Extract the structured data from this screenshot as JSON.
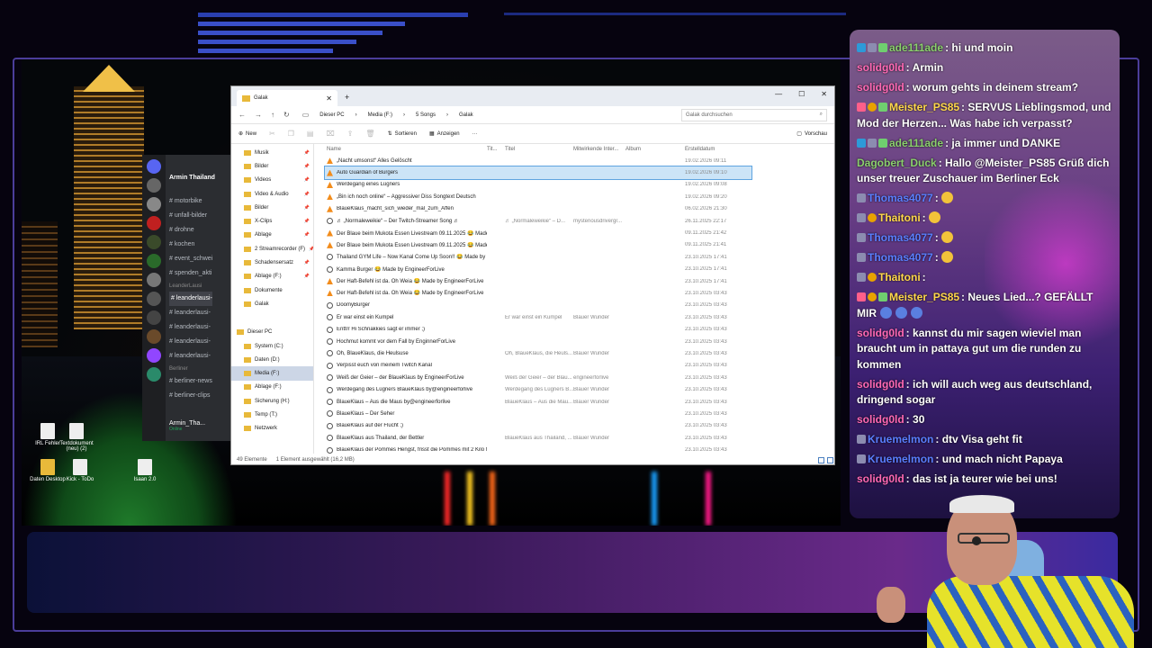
{
  "colors": {
    "chat_accent": "#8bd06d",
    "selection": "#cce4f7"
  },
  "desktop_icons": [
    {
      "label": "IRL Fehler",
      "type": "file"
    },
    {
      "label": "Textdokument (neu) (2)",
      "type": "file"
    },
    {
      "label": "Daten Desktop",
      "type": "folder"
    },
    {
      "label": "Kick - ToDo",
      "type": "file"
    },
    {
      "label": "Isaan 2.0",
      "type": "file"
    }
  ],
  "discord": {
    "server_name": "Armin Thailand",
    "channels": [
      {
        "label": "motorbike",
        "kind": "channel"
      },
      {
        "label": "unfall-bilder",
        "kind": "channel"
      },
      {
        "label": "drohne",
        "kind": "channel"
      },
      {
        "label": "kochen",
        "kind": "channel"
      },
      {
        "label": "event_schwei",
        "kind": "channel"
      },
      {
        "label": "spenden_akti",
        "kind": "channel"
      },
      {
        "label": "LeanderLausi",
        "kind": "category"
      },
      {
        "label": "leanderlausi-",
        "kind": "channel",
        "selected": true
      },
      {
        "label": "leanderlausi-",
        "kind": "channel"
      },
      {
        "label": "leanderlausi-",
        "kind": "channel"
      },
      {
        "label": "leanderlausi-",
        "kind": "channel"
      },
      {
        "label": "leanderlausi-",
        "kind": "channel"
      },
      {
        "label": "Berliner",
        "kind": "category"
      },
      {
        "label": "berliner-news",
        "kind": "channel"
      },
      {
        "label": "berliner-clips",
        "kind": "channel"
      }
    ],
    "user_name": "Armin_Tha...",
    "user_status": "Online"
  },
  "explorer": {
    "tab_title": "Galak",
    "breadcrumbs": [
      "Dieser PC",
      "Media (F:)",
      "5 Songs",
      "Galak"
    ],
    "search_placeholder": "Galak durchsuchen",
    "toolbar": {
      "new": "New",
      "sort": "Sortieren",
      "view": "Anzeigen",
      "more": "···",
      "preview": "Vorschau"
    },
    "nav_items": [
      {
        "label": "Musik",
        "pin": true
      },
      {
        "label": "Bilder",
        "pin": true
      },
      {
        "label": "Videos",
        "pin": true
      },
      {
        "label": "Video & Audio",
        "pin": true
      },
      {
        "label": "Bilder",
        "pin": true
      },
      {
        "label": "X-Clips",
        "pin": true
      },
      {
        "label": "Ablage",
        "pin": true
      },
      {
        "label": "2 Streamrecorder (F)",
        "pin": true
      },
      {
        "label": "Schadensersatz",
        "pin": true
      },
      {
        "label": "Ablage (F:)",
        "pin": true
      },
      {
        "label": "Dokumente"
      },
      {
        "label": "Galak"
      },
      {
        "label": "",
        "gap": true
      },
      {
        "label": "Dieser PC"
      },
      {
        "label": "System (C:)"
      },
      {
        "label": "Daten (D:)"
      },
      {
        "label": "Media (F:)",
        "selected": true
      },
      {
        "label": "Ablage (F:)"
      },
      {
        "label": "Sicherung (H:)"
      },
      {
        "label": "Temp (T:)"
      },
      {
        "label": "Netzwerk"
      }
    ],
    "columns": [
      "Name",
      "Tit...",
      "Titel",
      "Mitwirkende Inter...",
      "Album",
      "Erstelldatum"
    ],
    "rows": [
      {
        "name": "„Nacht umsonst“ Alles Gelöscht",
        "icon": "cone",
        "c2": "",
        "c3": "",
        "c4": "",
        "date": "19.02.2026 09:11"
      },
      {
        "name": "Auto Guardian of Burgers",
        "icon": "cone",
        "c2": "",
        "c3": "",
        "c4": "",
        "date": "19.02.2026 09:10",
        "selected": true
      },
      {
        "name": "Werdegang eines Lügners",
        "icon": "cone",
        "c2": "",
        "c3": "",
        "c4": "",
        "date": "19.02.2026 09:08"
      },
      {
        "name": "„Bin ich noch online“ – Aggressiver Diss Songtext Deutsch",
        "icon": "cone",
        "c2": "",
        "c3": "",
        "c4": "",
        "date": "19.02.2026 09:20"
      },
      {
        "name": "BlaueKlaus_macht_sich_wieder_mal_zum_Affen",
        "icon": "cone",
        "c2": "",
        "c3": "",
        "c4": "",
        "date": "06.02.2026 21:30"
      },
      {
        "name": "♬ „Normaleweikie“ – Der Twitch-Streamer Song ♬",
        "icon": "wmp",
        "c2": "♬ „Normaleweikie“ – D...",
        "c3": "mysteriousdrivergr...",
        "c4": "",
        "date": "26.11.2025 22:17"
      },
      {
        "name": "Der Blaue beim Mukota Essen Livestream 09.11.2025 😂 Made by ...",
        "icon": "cone",
        "c2": "",
        "c3": "",
        "c4": "",
        "date": "09.11.2025 21:42"
      },
      {
        "name": "Der Blaue beim Mukota Essen Livestream 09.11.2025 😂 Made by ...",
        "icon": "cone",
        "c2": "",
        "c3": "",
        "c4": "",
        "date": "09.11.2025 21:41"
      },
      {
        "name": "Thailand GYM Life – Now Kanal Come Up Soon!! 😂 Made by En...",
        "icon": "wmp",
        "c2": "",
        "c3": "",
        "c4": "",
        "date": "23.10.2025 17:41"
      },
      {
        "name": "Kamma Burger 😂 Made by EngineerForLive",
        "icon": "wmp",
        "c2": "",
        "c3": "",
        "c4": "",
        "date": "23.10.2025 17:41"
      },
      {
        "name": "Der Haft-Befehl ist da. Oh Weia 😂 Made by EngineerForLive",
        "icon": "cone",
        "c2": "",
        "c3": "",
        "c4": "",
        "date": "23.10.2025 17:41"
      },
      {
        "name": "Der Haft-Befehl ist da. Oh Weia 😂 Made by EngineerForLive",
        "icon": "cone",
        "c2": "",
        "c3": "",
        "c4": "",
        "date": "23.10.2025 03:43"
      },
      {
        "name": "DoomyBurger",
        "icon": "wmp",
        "c2": "",
        "c3": "",
        "c4": "",
        "date": "23.10.2025 03:43"
      },
      {
        "name": "Er war einst ein Kumpel",
        "icon": "wmp",
        "c2": "Er war einst ein Kumpel",
        "c3": "Blauer Wunder",
        "c4": "",
        "date": "23.10.2025 03:43"
      },
      {
        "name": "Enttrr Hi Schnakkies sagt er immer ;)",
        "icon": "wmp",
        "c2": "",
        "c3": "",
        "c4": "",
        "date": "23.10.2025 03:43"
      },
      {
        "name": "Hochmut kommt vor dem Fall by EnginnerForLive",
        "icon": "wmp",
        "c2": "",
        "c3": "",
        "c4": "",
        "date": "23.10.2025 03:43"
      },
      {
        "name": "Oh, BlaueKlaus, die Heulsuse",
        "icon": "wmp",
        "c2": "Oh, BlaueKlaus, die Heuls...",
        "c3": "Blauer Wunder",
        "c4": "",
        "date": "23.10.2025 03:43"
      },
      {
        "name": "Verpisst euch von meinem Twitch Kanal",
        "icon": "wmp",
        "c2": "",
        "c3": "",
        "c4": "",
        "date": "23.10.2025 03:43"
      },
      {
        "name": "Weiß der Geier – der BlaueKlaus by EngineerForLive",
        "icon": "wmp",
        "c2": "Weiß der Geier – der Blau...",
        "c3": "engineerforlive",
        "c4": "",
        "date": "23.10.2025 03:43"
      },
      {
        "name": "Werdegang des Lügners BlaueKlaus by@engineerforlive",
        "icon": "wmp",
        "c2": "Werdegang des Lügners B...",
        "c3": "Blauer Wunder",
        "c4": "",
        "date": "23.10.2025 03:43"
      },
      {
        "name": "BlaueKlaus – Aus die Maus by@engineerforlive",
        "icon": "wmp",
        "c2": "BlaueKlaus – Aus die Mau...",
        "c3": "Blauer Wunder",
        "c4": "",
        "date": "23.10.2025 03:43"
      },
      {
        "name": "BlaueKlaus – Der Seher",
        "icon": "wmp",
        "c2": "",
        "c3": "",
        "c4": "",
        "date": "23.10.2025 03:43"
      },
      {
        "name": "BlaueKlaus auf der Flucht ;)",
        "icon": "wmp",
        "c2": "",
        "c3": "",
        "c4": "",
        "date": "23.10.2025 03:43"
      },
      {
        "name": "BlaueKlaus aus Thailand, der Bettler",
        "icon": "wmp",
        "c2": "BlaueKlaus aus Thailand, ...",
        "c3": "Blauer Wunder",
        "c4": "",
        "date": "23.10.2025 03:43"
      },
      {
        "name": "BlaueKlaus der Pommes Hengst, frisst die Pommes mit 2 Kilo M...",
        "icon": "wmp",
        "c2": "",
        "c3": "",
        "c4": "",
        "date": "23.10.2025 03:43"
      }
    ],
    "status_count": "49 Elemente",
    "status_selected": "1 Element ausgewählt (16,2 MB)"
  },
  "chat": [
    {
      "badges": [
        "pr",
        "mod",
        "gift"
      ],
      "user": "ade111ade",
      "color": "#8bd06d",
      "text": "hi und moin"
    },
    {
      "badges": [],
      "user": "solidg0ld",
      "color": "#ff69b4",
      "text": "Armin"
    },
    {
      "badges": [],
      "user": "solidg0ld",
      "color": "#ff69b4",
      "text": "worum gehts in deinem stream?"
    },
    {
      "badges": [
        "vip",
        "sub",
        "gift"
      ],
      "user": "Meister_PS85",
      "color": "#ffd84a",
      "text": "SERVUS Lieblingsmod, und Mod der Herzen... Was habe ich verpasst?"
    },
    {
      "badges": [
        "pr",
        "mod",
        "gift"
      ],
      "user": "ade111ade",
      "color": "#8bd06d",
      "text": "ja immer und DANKE"
    },
    {
      "badges": [],
      "user": "Dagobert_Duck",
      "color": "#8bd06d",
      "text": "Hallo @Meister_PS85 Grüß dich unser treuer Zuschauer im Berliner Eck"
    },
    {
      "badges": [
        "mod"
      ],
      "user": "Thomas4077",
      "color": "#5a7fff",
      "text": "",
      "emote": "yellow"
    },
    {
      "badges": [
        "mod",
        "sub"
      ],
      "user": "Thaitoni",
      "color": "#ffd84a",
      "text": "",
      "emote": "yellow"
    },
    {
      "badges": [
        "mod"
      ],
      "user": "Thomas4077",
      "color": "#5a7fff",
      "text": "",
      "emote": "yellow"
    },
    {
      "badges": [
        "mod"
      ],
      "user": "Thomas4077",
      "color": "#5a7fff",
      "text": "",
      "emote": "yellow"
    },
    {
      "badges": [
        "mod",
        "sub"
      ],
      "user": "Thaitoni",
      "color": "#ffd84a",
      "text": "",
      "emote": ""
    },
    {
      "badges": [
        "vip",
        "sub",
        "gift"
      ],
      "user": "Meister_PS85",
      "color": "#ffd84a",
      "text": "Neues Lied...? GEFÄLLT MIR",
      "emote": "blue3"
    },
    {
      "badges": [],
      "user": "solidg0ld",
      "color": "#ff69b4",
      "text": "kannst du mir sagen wieviel man braucht um in pattaya gut um die runden zu kommen"
    },
    {
      "badges": [],
      "user": "solidg0ld",
      "color": "#ff69b4",
      "text": "ich will auch weg aus deutschland, dringend sogar"
    },
    {
      "badges": [],
      "user": "solidg0ld",
      "color": "#ff69b4",
      "text": "30"
    },
    {
      "badges": [
        "mod"
      ],
      "user": "Kruemelmon",
      "color": "#5a7fff",
      "text": "dtv Visa geht fit"
    },
    {
      "badges": [
        "mod"
      ],
      "user": "Kruemelmon",
      "color": "#5a7fff",
      "text": "und mach nicht Papaya"
    },
    {
      "badges": [],
      "user": "solidg0ld",
      "color": "#ff69b4",
      "text": "das ist ja teurer wie bei uns!"
    }
  ]
}
